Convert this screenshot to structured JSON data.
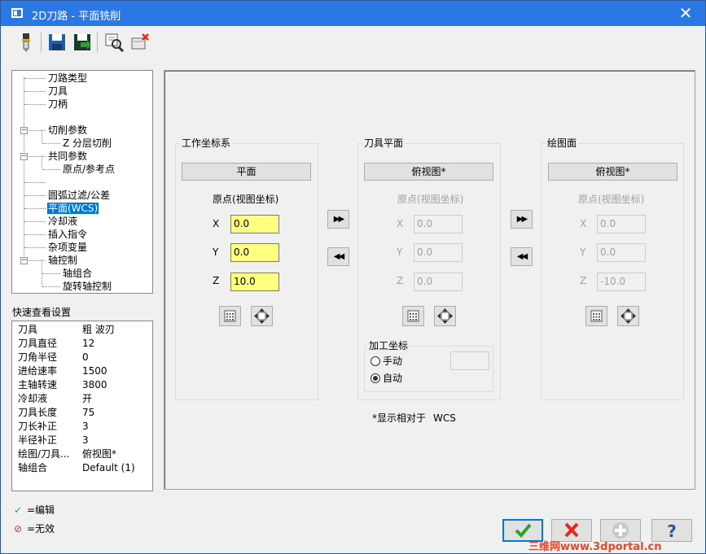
{
  "window": {
    "title": "2D刀路 - 平面铣削",
    "close_glyph": "✕"
  },
  "toolbar": {
    "icons": [
      "tool-icon",
      "save-icon",
      "save-as-icon",
      "preview-icon",
      "disable-icon"
    ]
  },
  "tree": {
    "items": [
      {
        "label": "刀路类型"
      },
      {
        "label": "刀具"
      },
      {
        "label": "刀柄"
      },
      {
        "label": "切削参数"
      },
      {
        "label": "Z 分层切削"
      },
      {
        "label": "共同参数"
      },
      {
        "label": "原点/参考点"
      },
      {
        "label": "圆弧过滤/公差"
      },
      {
        "label": "平面(WCS)"
      },
      {
        "label": "冷却液"
      },
      {
        "label": "插入指令"
      },
      {
        "label": "杂项变量"
      },
      {
        "label": "轴控制"
      },
      {
        "label": "轴组合"
      },
      {
        "label": "旋转轴控制"
      }
    ]
  },
  "quick_view": {
    "title": "快速查看设置",
    "rows": [
      {
        "k": "刀具",
        "v": "粗 波刃"
      },
      {
        "k": "刀具直径",
        "v": "12"
      },
      {
        "k": "刀角半径",
        "v": "0"
      },
      {
        "k": "进给速率",
        "v": "1500"
      },
      {
        "k": "主轴转速",
        "v": "3800"
      },
      {
        "k": "冷却液",
        "v": "开"
      },
      {
        "k": "刀具长度",
        "v": "75"
      },
      {
        "k": "刀长补正",
        "v": "3"
      },
      {
        "k": "半径补正",
        "v": "3"
      },
      {
        "k": "绘图/刀具...",
        "v": "俯视图*"
      },
      {
        "k": "轴组合",
        "v": "Default (1)"
      }
    ]
  },
  "legend": {
    "edit_symbol": "✓",
    "edit_label": "=编辑",
    "invalid_symbol": "⊘",
    "invalid_label": "=无效"
  },
  "wcs": {
    "title": "工作坐标系",
    "plane_button": "平面",
    "origin_label": "原点(视图坐标)",
    "x_label": "X",
    "y_label": "Y",
    "z_label": "Z",
    "x": "0.0",
    "y": "0.0",
    "z": "10.0"
  },
  "tool_plane": {
    "title": "刀具平面",
    "plane_button": "俯视图*",
    "origin_label": "原点(视图坐标)",
    "x_label": "X",
    "y_label": "Y",
    "z_label": "Z",
    "x": "0.0",
    "y": "0.0",
    "z": "0.0",
    "work_offset": {
      "title": "加工坐标",
      "manual": "手动",
      "auto": "自动",
      "selected": "自动",
      "value": ""
    }
  },
  "construction_plane": {
    "title": "绘图面",
    "plane_button": "俯视图*",
    "origin_label": "原点(视图坐标)",
    "x_label": "X",
    "y_label": "Y",
    "z_label": "Z",
    "x": "0.0",
    "y": "0.0",
    "z": "-10.0"
  },
  "footer_note": {
    "label": "*显示相对于",
    "value": "WCS"
  },
  "transfer": {
    "copy_right": "▶▶",
    "copy_left": "◀◀"
  },
  "buttons": [
    "ok-icon",
    "cancel-icon",
    "add-icon",
    "help-icon"
  ],
  "watermark": "三维网www.3dportal.cn",
  "colors": {
    "title_bar": "#2b78e4",
    "selection": "#0078d7",
    "input_highlight": "#ffff80",
    "ok_green": "#2aa12a",
    "cancel_red": "#e8271e"
  }
}
